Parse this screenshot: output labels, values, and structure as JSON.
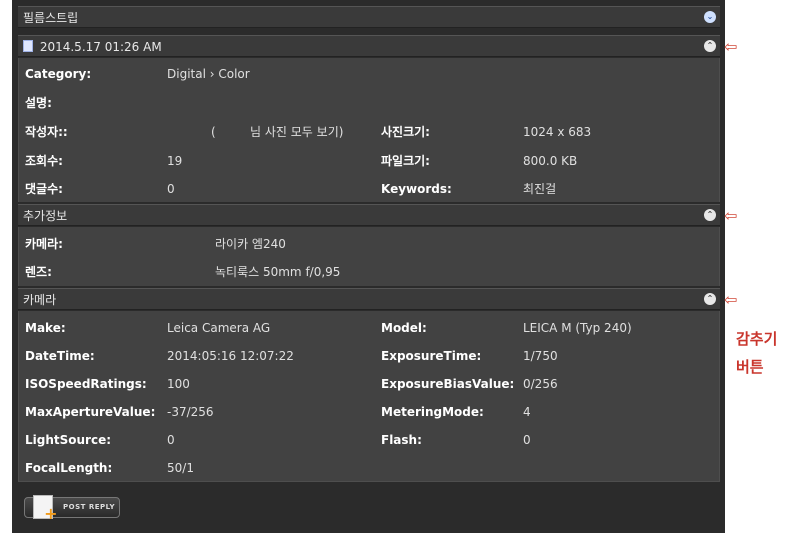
{
  "filmstrip": {
    "title": "필름스트립"
  },
  "photo": {
    "date": "2014.5.17 01:26 AM",
    "rows_left": [
      {
        "label": "Category:",
        "value": "Digital › Color"
      },
      {
        "label": "설명:",
        "value": ""
      },
      {
        "label": "작성자::",
        "value": "(         님 사진 모두 보기)"
      },
      {
        "label": "조회수:",
        "value": "19"
      },
      {
        "label": "댓글수:",
        "value": "0"
      }
    ],
    "rows_right": [
      {
        "label": "사진크기:",
        "value": "1024 x 683"
      },
      {
        "label": "파일크기:",
        "value": "800.0 KB"
      },
      {
        "label": "Keywords:",
        "value": "최진걸"
      }
    ]
  },
  "extra": {
    "title": "추가정보",
    "rows": [
      {
        "label": "카메라:",
        "value": "라이카 엠240"
      },
      {
        "label": "렌즈:",
        "value": "녹티룩스 50mm f/0,95"
      }
    ]
  },
  "camera": {
    "title": "카메라",
    "left": [
      {
        "label": "Make:",
        "value": "Leica Camera AG"
      },
      {
        "label": "DateTime:",
        "value": "2014:05:16 12:07:22"
      },
      {
        "label": "ISOSpeedRatings:",
        "value": "100"
      },
      {
        "label": "MaxApertureValue:",
        "value": "-37/256"
      },
      {
        "label": "LightSource:",
        "value": "0"
      },
      {
        "label": "FocalLength:",
        "value": "50/1"
      }
    ],
    "right": [
      {
        "label": "Model:",
        "value": "LEICA M (Typ 240)"
      },
      {
        "label": "ExposureTime:",
        "value": "1/750"
      },
      {
        "label": "ExposureBiasValue:",
        "value": "0/256"
      },
      {
        "label": "MeteringMode:",
        "value": "4"
      },
      {
        "label": "Flash:",
        "value": "0"
      }
    ]
  },
  "reply_button": {
    "label": "POST REPLY"
  },
  "annotation": {
    "line1": "감추기",
    "line2": "버튼"
  },
  "colors": {
    "panel": "#2b2b2b",
    "section": "#424242",
    "annotation": "#c9352c"
  },
  "icons": {
    "filmstrip_toggle": "chevron-down-circle-icon",
    "section_toggle": "chevron-up-circle-icon"
  }
}
